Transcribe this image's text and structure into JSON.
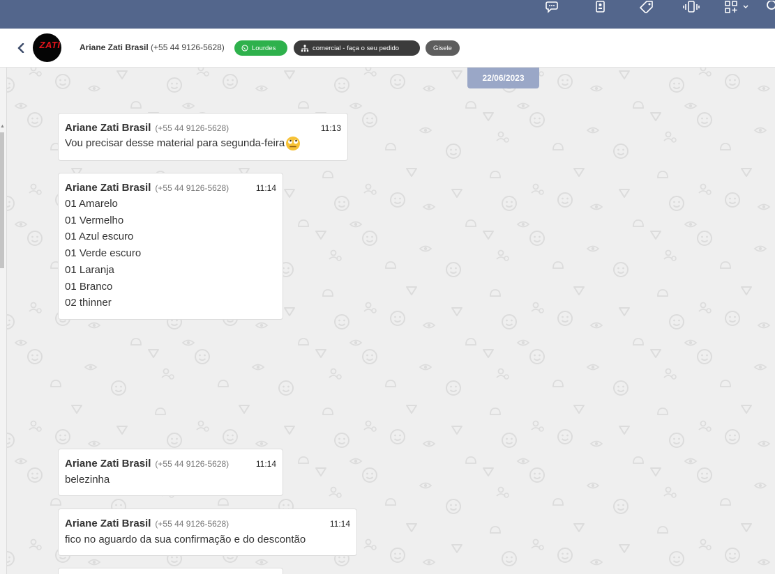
{
  "topbar": {
    "icons": [
      "chat-bubbles-icon",
      "contact-card-icon",
      "tag-icon",
      "phone-vibrate-icon",
      "apps-add-icon",
      "chevron-down-icon",
      "search-icon"
    ]
  },
  "header": {
    "contact_name": "Ariane Zati Brasil",
    "contact_phone": "(+55 44 9126-5628)",
    "tags": {
      "channel": "Lourdes",
      "department": "comercial - faça o seu pedido",
      "user": "Gisele"
    },
    "colors": {
      "channel": "#2eb14c",
      "department": "#3b3b3b",
      "user": "#5d5d5d"
    }
  },
  "date_badge": "22/06/2023",
  "messages": [
    {
      "sender": "Ariane Zati Brasil",
      "phone": "(+55 44 9126-5628)",
      "time": "11:13",
      "lines": [
        "Vou precisar desse material para segunda-feira"
      ],
      "emoji": "rolling-eyes-emoji"
    },
    {
      "sender": "Ariane Zati Brasil",
      "phone": "(+55 44 9126-5628)",
      "time": "11:14",
      "lines": [
        "01 Amarelo",
        "01 Vermelho",
        "01 Azul escuro",
        "01 Verde escuro",
        "01 Laranja",
        "01 Branco",
        "02 thinner"
      ]
    },
    {
      "sender": "Ariane Zati Brasil",
      "phone": "(+55 44 9126-5628)",
      "time": "11:14",
      "lines": [
        "belezinha"
      ]
    },
    {
      "sender": "Ariane Zati Brasil",
      "phone": "(+55 44 9126-5628)",
      "time": "11:14",
      "lines": [
        "fico no aguardo da sua confirmação e do descontão"
      ]
    }
  ]
}
